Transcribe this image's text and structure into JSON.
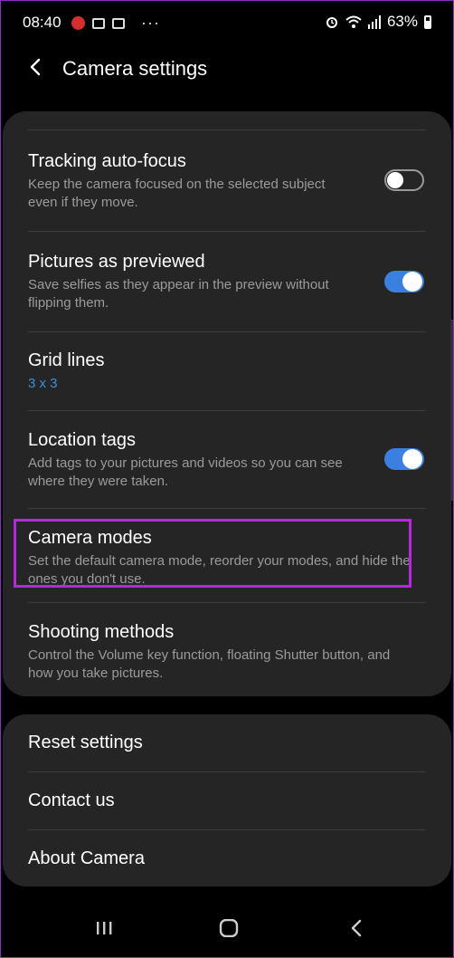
{
  "status_bar": {
    "time": "08:40",
    "battery": "63%",
    "more": "···"
  },
  "header": {
    "title": "Camera settings"
  },
  "settings": [
    {
      "title": "Tracking auto-focus",
      "subtitle": "Keep the camera focused on the selected subject even if they move.",
      "toggle": "off"
    },
    {
      "title": "Pictures as previewed",
      "subtitle": "Save selfies as they appear in the preview without flipping them.",
      "toggle": "on"
    },
    {
      "title": "Grid lines",
      "subtitle": "3 x 3"
    },
    {
      "title": "Location tags",
      "subtitle": "Add tags to your pictures and videos so you can see where they were taken.",
      "toggle": "on"
    },
    {
      "title": "Camera modes",
      "subtitle": "Set the default camera mode, reorder your modes, and hide the ones you don't use."
    },
    {
      "title": "Shooting methods",
      "subtitle": "Control the Volume key function, floating Shutter button, and how you take pictures."
    }
  ],
  "more_items": [
    {
      "title": "Reset settings"
    },
    {
      "title": "Contact us"
    },
    {
      "title": "About Camera"
    }
  ],
  "colors": {
    "accent": "#3b7fe0",
    "highlight": "#b826e0",
    "card": "#252525"
  }
}
